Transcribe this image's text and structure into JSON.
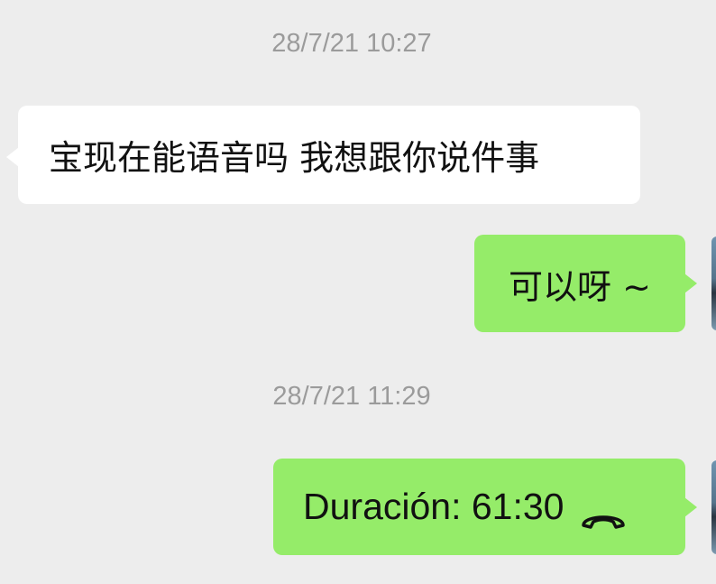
{
  "messages": {
    "timestamp_1": "28/7/21 10:27",
    "incoming_1": "宝现在能语音吗 我想跟你说件事",
    "outgoing_1": "可以呀 ~",
    "timestamp_2": "28/7/21 11:29",
    "outgoing_2_call": "Duración: 61:30"
  },
  "colors": {
    "background": "#ededed",
    "incoming_bubble": "#ffffff",
    "outgoing_bubble": "#95ec69",
    "timestamp_text": "#9b9b9b"
  },
  "icons": {
    "call_ended": "phone-hangup-icon"
  }
}
